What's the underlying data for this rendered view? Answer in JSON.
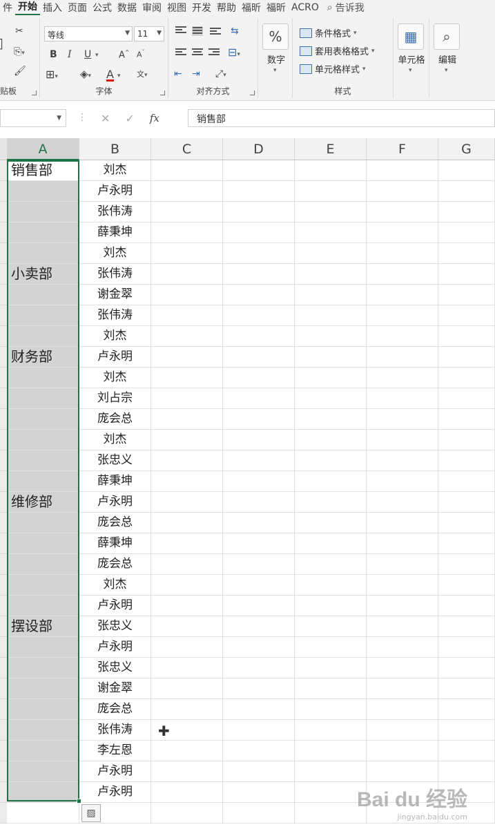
{
  "ribbon_tabs": [
    {
      "label": "件"
    },
    {
      "label": "开始",
      "active": true
    },
    {
      "label": "插入"
    },
    {
      "label": "页面"
    },
    {
      "label": "公式"
    },
    {
      "label": "数据"
    },
    {
      "label": "审阅"
    },
    {
      "label": "视图"
    },
    {
      "label": "开发"
    },
    {
      "label": "帮助"
    },
    {
      "label": "福昕"
    },
    {
      "label": "福昕"
    },
    {
      "label": "ACRO"
    }
  ],
  "tell_me": "告诉我",
  "clipboard": {
    "label": "贴板"
  },
  "font": {
    "label": "字体",
    "name": "等线",
    "size": "11",
    "bold": "B",
    "italic": "I",
    "underline": "U",
    "grow": "A",
    "shrink": "A",
    "font_color": "A",
    "phonetic": "文"
  },
  "alignment": {
    "label": "对齐方式"
  },
  "number": {
    "label": "数字",
    "icon_text": "%"
  },
  "styles": {
    "label": "样式",
    "items": [
      "条件格式",
      "套用表格格式",
      "单元格样式"
    ]
  },
  "cells": {
    "label": "单元格"
  },
  "editing": {
    "label": "编辑"
  },
  "formula_bar": {
    "name_box": "",
    "value": "销售部"
  },
  "columns": [
    "A",
    "B",
    "C",
    "D",
    "E",
    "F",
    "G"
  ],
  "rows": [
    {
      "a": "销售部",
      "b": "刘杰"
    },
    {
      "a": "",
      "b": "卢永明"
    },
    {
      "a": "",
      "b": "张伟涛"
    },
    {
      "a": "",
      "b": "薛秉坤"
    },
    {
      "a": "",
      "b": "刘杰"
    },
    {
      "a": "小卖部",
      "b": "张伟涛"
    },
    {
      "a": "",
      "b": "谢金翠"
    },
    {
      "a": "",
      "b": "张伟涛"
    },
    {
      "a": "",
      "b": "刘杰"
    },
    {
      "a": "财务部",
      "b": "卢永明"
    },
    {
      "a": "",
      "b": "刘杰"
    },
    {
      "a": "",
      "b": "刘占宗"
    },
    {
      "a": "",
      "b": "庞会总"
    },
    {
      "a": "",
      "b": "刘杰"
    },
    {
      "a": "",
      "b": "张忠义"
    },
    {
      "a": "",
      "b": "薛秉坤"
    },
    {
      "a": "维修部",
      "b": "卢永明"
    },
    {
      "a": "",
      "b": "庞会总"
    },
    {
      "a": "",
      "b": "薛秉坤"
    },
    {
      "a": "",
      "b": "庞会总"
    },
    {
      "a": "",
      "b": "刘杰"
    },
    {
      "a": "",
      "b": "卢永明"
    },
    {
      "a": "摆设部",
      "b": "张忠义"
    },
    {
      "a": "",
      "b": "卢永明"
    },
    {
      "a": "",
      "b": "张忠义"
    },
    {
      "a": "",
      "b": "谢金翠"
    },
    {
      "a": "",
      "b": "庞会总"
    },
    {
      "a": "",
      "b": "张伟涛"
    },
    {
      "a": "",
      "b": "李左恩"
    },
    {
      "a": "",
      "b": "卢永明"
    },
    {
      "a": "",
      "b": "卢永明"
    }
  ],
  "watermark": {
    "brand": "Bai du 经验",
    "url": "jingyan.baidu.com"
  },
  "colors": {
    "accent": "#217346",
    "selection_fill": "#d3d3d3",
    "ribbon_bg": "#f3f3f3"
  }
}
